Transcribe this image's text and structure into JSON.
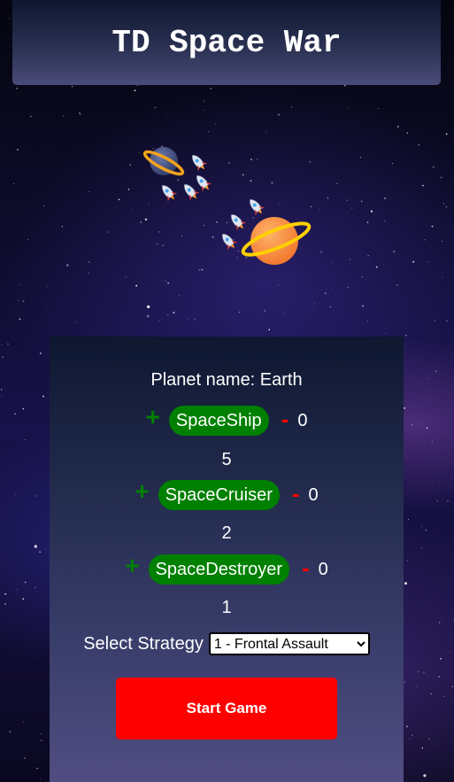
{
  "header": {
    "title": "TD Space War"
  },
  "panel": {
    "planet_name": "Planet name: Earth",
    "units": [
      {
        "name": "SpaceShip",
        "plus": "+",
        "minus": "-",
        "count": "0",
        "value": "5"
      },
      {
        "name": "SpaceCruiser",
        "plus": "+",
        "minus": "-",
        "count": "0",
        "value": "2"
      },
      {
        "name": "SpaceDestroyer",
        "plus": "+",
        "minus": "-",
        "count": "0",
        "value": "1"
      }
    ],
    "strategy": {
      "label": "Select Strategy",
      "selected": "1 - Frontal Assault"
    },
    "start_button": "Start Game"
  },
  "colors": {
    "plus": "#008000",
    "unit_pill": "#008000",
    "minus": "#ff0000",
    "start_button": "#ff0000"
  },
  "icons": {
    "planets": [
      "ringed-planet-icon",
      "ringed-planet-icon"
    ],
    "ships": "rocket-icon"
  }
}
